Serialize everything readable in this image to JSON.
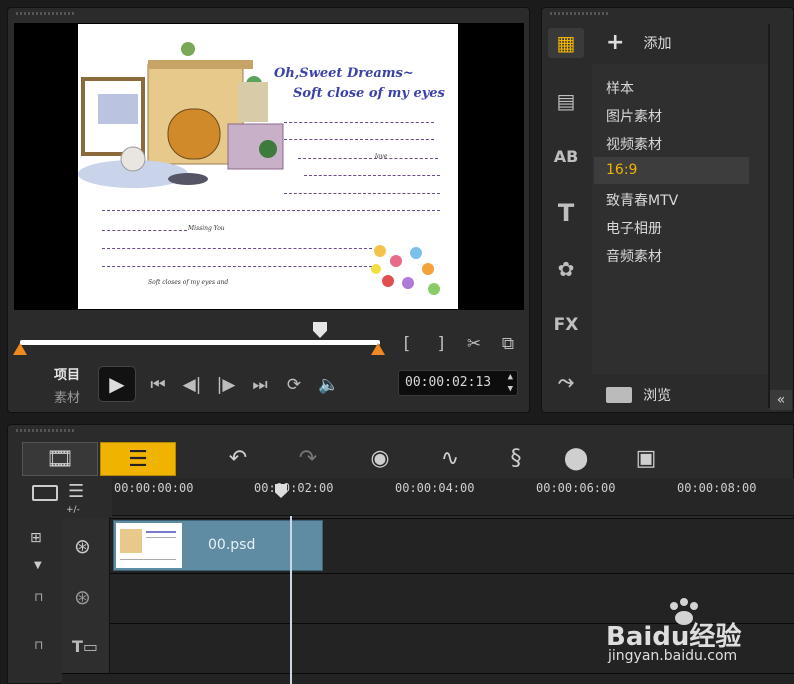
{
  "preview": {
    "card_title_line1": "Oh,Sweet Dreams~",
    "card_title_line2": "Soft close of my eyes",
    "card_love": "love",
    "card_missing": "Missing You",
    "card_footer": "Soft closes of my eyes and",
    "mode_project": "项目",
    "mode_clip": "素材",
    "timecode": "00:00:02:13",
    "playhead_fraction": 0.83
  },
  "library": {
    "add_label": "添加",
    "items": [
      "样本",
      "图片素材",
      "视频素材",
      "16:9",
      "致青春MTV",
      "电子相册",
      "音频素材"
    ],
    "selected_index": 3,
    "browse_label": "浏览",
    "side_icons": [
      "media-icon",
      "instant-project-icon",
      "transition-icon",
      "title-icon",
      "graphic-icon",
      "filter-icon",
      "path-icon"
    ]
  },
  "timeline": {
    "ruler": [
      "00:00:00:00",
      "00:00:02:00",
      "00:00:04:00",
      "00:00:06:00",
      "00:00:08:00"
    ],
    "clip_name": "00.psd",
    "zoom_label": "+/-"
  },
  "watermark": {
    "brand": "Baidu经验",
    "url": "jingyan.baidu.com"
  },
  "colors": {
    "accent_orange": "#f0b400",
    "clip_blue": "#5f8ba3",
    "selected_row": "#3d3d3d"
  }
}
